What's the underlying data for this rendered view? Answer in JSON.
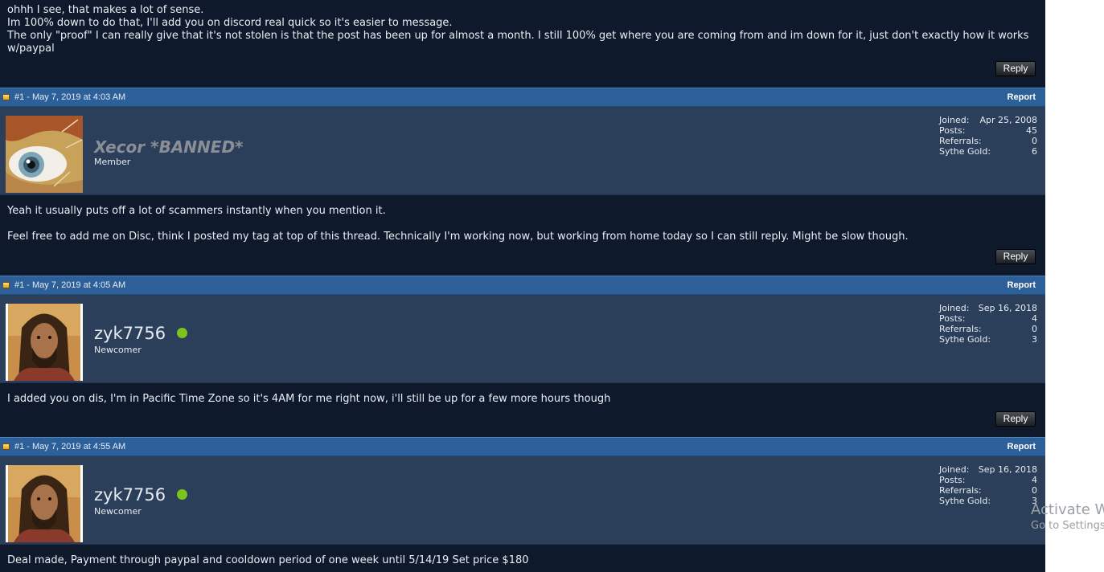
{
  "top_post": {
    "lines": [
      "ohhh I see, that makes a lot of sense.",
      "Im 100% down to do that, I'll add you on discord real quick so it's easier to message.",
      "The only \"proof\" I can really give that it's not stolen is that the post has been up for almost a month. I still 100% get where you are coming from and im down for it, just don't exactly how it works w/paypal"
    ],
    "reply_label": "Reply"
  },
  "posts": [
    {
      "date": "#1 - May 7, 2019 at 4:03 AM",
      "report_label": "Report",
      "username": "Xecor *BANNED*",
      "rank": "Member",
      "online": false,
      "stats": {
        "joined_label": "Joined:",
        "joined": "Apr 25, 2008",
        "posts_label": "Posts:",
        "posts": "45",
        "referrals_label": "Referrals:",
        "referrals": "0",
        "gold_label": "Sythe Gold:",
        "gold": "6"
      },
      "body": [
        "Yeah it usually puts off a lot of scammers instantly when you mention it.",
        "Feel free to add me on Disc, think I posted my tag at top of this thread. Technically I'm working now, but working from home today so I can still reply. Might be slow though."
      ],
      "reply_label": "Reply"
    },
    {
      "date": "#1 - May 7, 2019 at 4:05 AM",
      "report_label": "Report",
      "username": "zyk7756",
      "rank": "Newcomer",
      "online": true,
      "stats": {
        "joined_label": "Joined:",
        "joined": "Sep 16, 2018",
        "posts_label": "Posts:",
        "posts": "4",
        "referrals_label": "Referrals:",
        "referrals": "0",
        "gold_label": "Sythe Gold:",
        "gold": "3"
      },
      "body": [
        "I added you on dis, I'm in Pacific Time Zone so it's 4AM for me right now, i'll still be up for a few more hours though"
      ],
      "reply_label": "Reply"
    },
    {
      "date": "#1 - May 7, 2019 at 4:55 AM",
      "report_label": "Report",
      "username": "zyk7756",
      "rank": "Newcomer",
      "online": true,
      "stats": {
        "joined_label": "Joined:",
        "joined": "Sep 16, 2018",
        "posts_label": "Posts:",
        "posts": "4",
        "referrals_label": "Referrals:",
        "referrals": "0",
        "gold_label": "Sythe Gold:",
        "gold": "3"
      },
      "body": [
        "Deal made, Payment through paypal and cooldown period of one week until 5/14/19 Set price $180"
      ]
    }
  ],
  "watermark": {
    "line1": "Activate W",
    "line2": "Go to Settings"
  },
  "colors": {
    "page_bg": "#0e1a2b",
    "header_bar": "#2d6099",
    "user_bar": "#2c3f5a",
    "online": "#7cc41c"
  }
}
